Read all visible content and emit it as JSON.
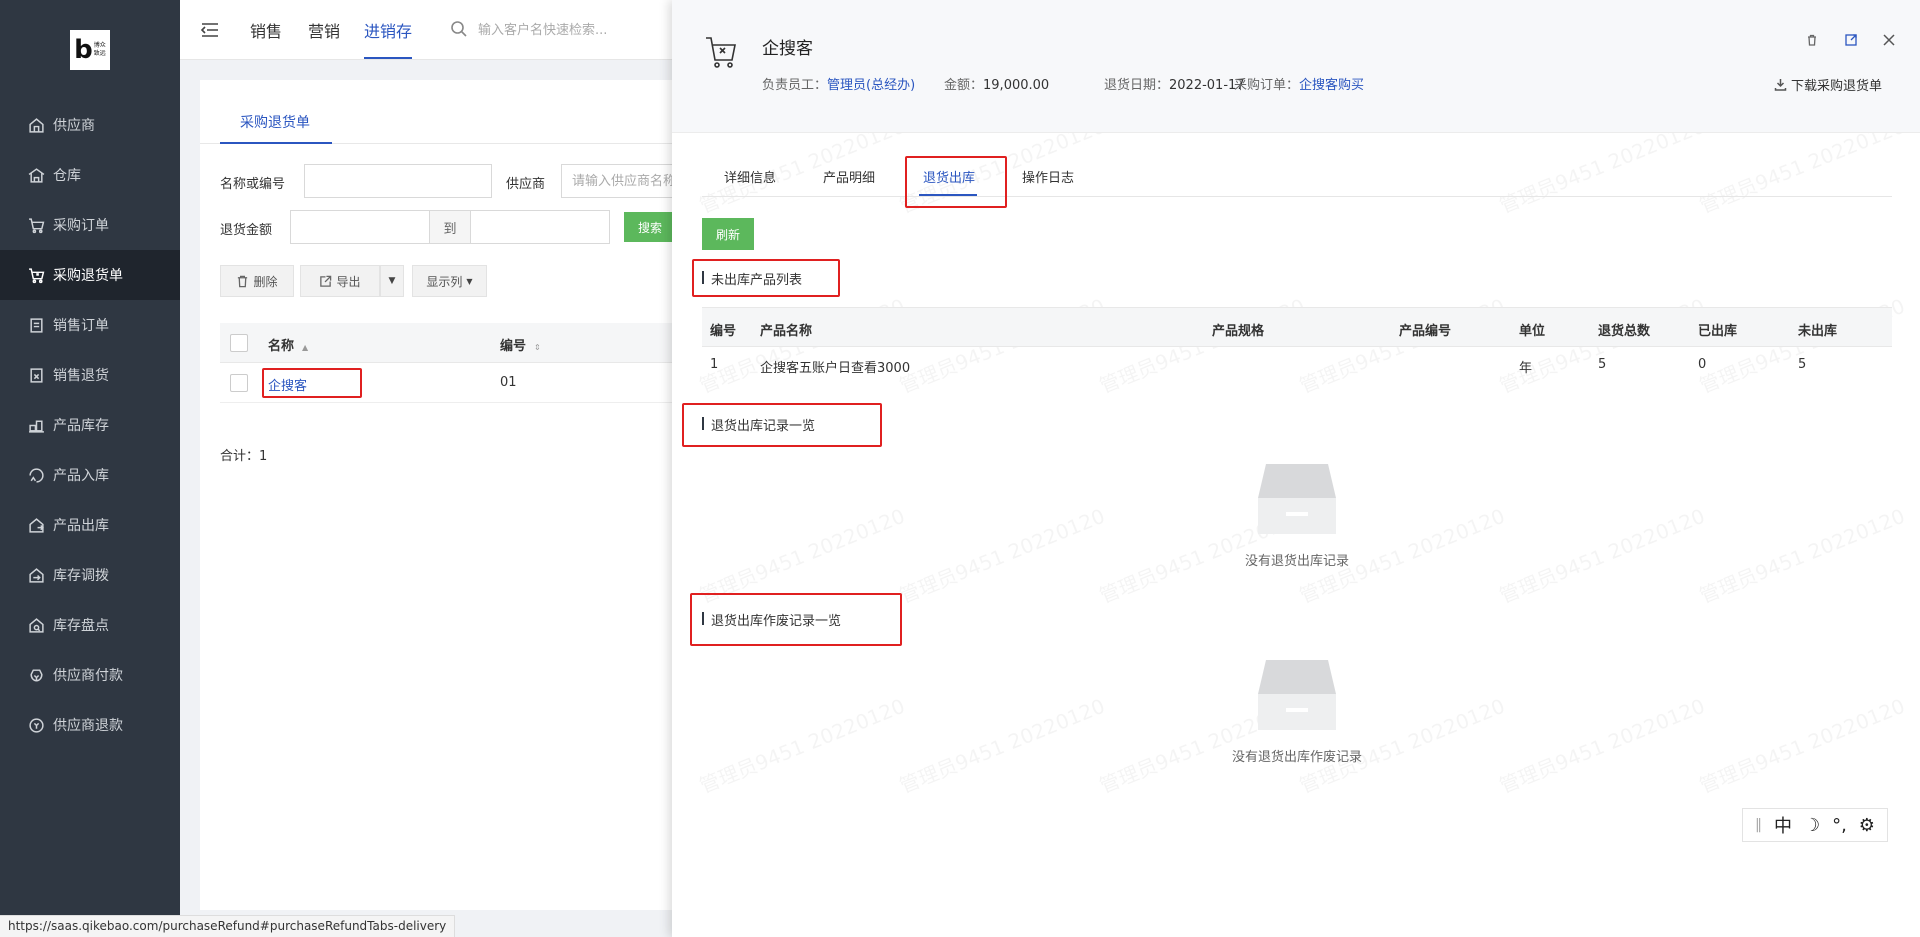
{
  "sidebar": {
    "logo_letter": "b",
    "logo_text1": "博众",
    "logo_text2": "致远",
    "items": [
      {
        "label": "供应商",
        "icon": "supplier-icon"
      },
      {
        "label": "仓库",
        "icon": "warehouse-icon"
      },
      {
        "label": "采购订单",
        "icon": "cart-icon"
      },
      {
        "label": "采购退货单",
        "icon": "cart-return-icon",
        "active": true
      },
      {
        "label": "销售订单",
        "icon": "order-icon"
      },
      {
        "label": "销售退货",
        "icon": "sales-return-icon"
      },
      {
        "label": "产品库存",
        "icon": "stock-icon"
      },
      {
        "label": "产品入库",
        "icon": "inbound-icon"
      },
      {
        "label": "产品出库",
        "icon": "outbound-icon"
      },
      {
        "label": "库存调拨",
        "icon": "transfer-icon"
      },
      {
        "label": "库存盘点",
        "icon": "inventory-check-icon"
      },
      {
        "label": "供应商付款",
        "icon": "payment-icon"
      },
      {
        "label": "供应商退款",
        "icon": "refund-icon"
      }
    ]
  },
  "topbar": {
    "tabs": [
      "销售",
      "营销",
      "进销存"
    ],
    "active_tab": "进销存",
    "search_placeholder": "输入客户名快速检索..."
  },
  "main": {
    "tab_label": "采购退货单",
    "filter": {
      "name_label": "名称或编号",
      "supplier_label": "供应商",
      "supplier_placeholder": "请输入供应商名称",
      "amount_label": "退货金额",
      "to_label": "到",
      "search_btn": "搜索"
    },
    "toolbar": {
      "delete": "删除",
      "export": "导出",
      "columns": "显示列"
    },
    "table": {
      "headers": [
        "名称",
        "编号"
      ],
      "rows": [
        {
          "name": "企搜客",
          "code": "01"
        }
      ]
    },
    "total": "合计：1"
  },
  "drawer": {
    "title": "企搜客",
    "meta": {
      "owner_label": "负责员工：",
      "owner_value": "管理员(总经办)",
      "amount_label": "金额：",
      "amount_value": "19,000.00",
      "date_label": "退货日期：",
      "date_value": "2022-01-17",
      "po_label": "采购订单：",
      "po_value": "企搜客购买"
    },
    "download_btn": "下载采购退货单",
    "tabs": [
      "详细信息",
      "产品明细",
      "退货出库",
      "操作日志"
    ],
    "active_tab": "退货出库",
    "refresh_btn": "刷新",
    "section1_title": "未出库产品列表",
    "product_table": {
      "headers": [
        "编号",
        "产品名称",
        "产品规格",
        "产品编号",
        "单位",
        "退货总数",
        "已出库",
        "未出库"
      ],
      "rows": [
        {
          "no": "1",
          "name": "企搜客五账户日查看3000",
          "spec": "",
          "code": "",
          "unit": "年",
          "total": "5",
          "out": "0",
          "remaining": "5"
        }
      ]
    },
    "section2_title": "退货出库记录一览",
    "empty1_text": "没有退货出库记录",
    "section3_title": "退货出库作废记录一览",
    "empty2_text": "没有退货出库作废记录",
    "watermark_text": "管理员9451 20220120"
  },
  "ime": {
    "chinese": "中",
    "moon": "☽",
    "punct": "°,",
    "gear": "⚙"
  },
  "status_url": "https://saas.qikebao.com/purchaseRefund#purchaseRefundTabs-delivery"
}
